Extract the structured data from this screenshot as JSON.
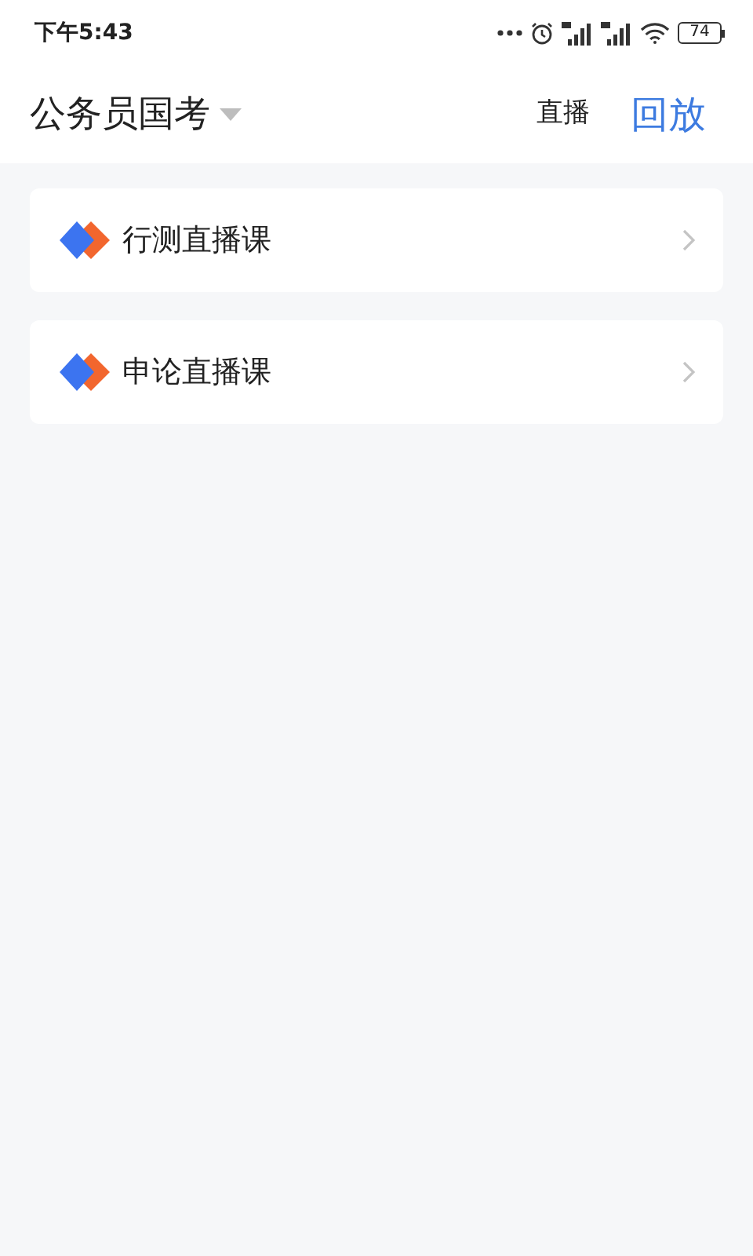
{
  "status_bar": {
    "time": "下午5:43",
    "battery": "74"
  },
  "header": {
    "title": "公务员国考",
    "tabs": [
      {
        "label": "直播",
        "selected": false
      },
      {
        "label": "回放",
        "selected": true
      }
    ]
  },
  "courses": [
    {
      "label": "行测直播课"
    },
    {
      "label": "申论直播课"
    }
  ]
}
